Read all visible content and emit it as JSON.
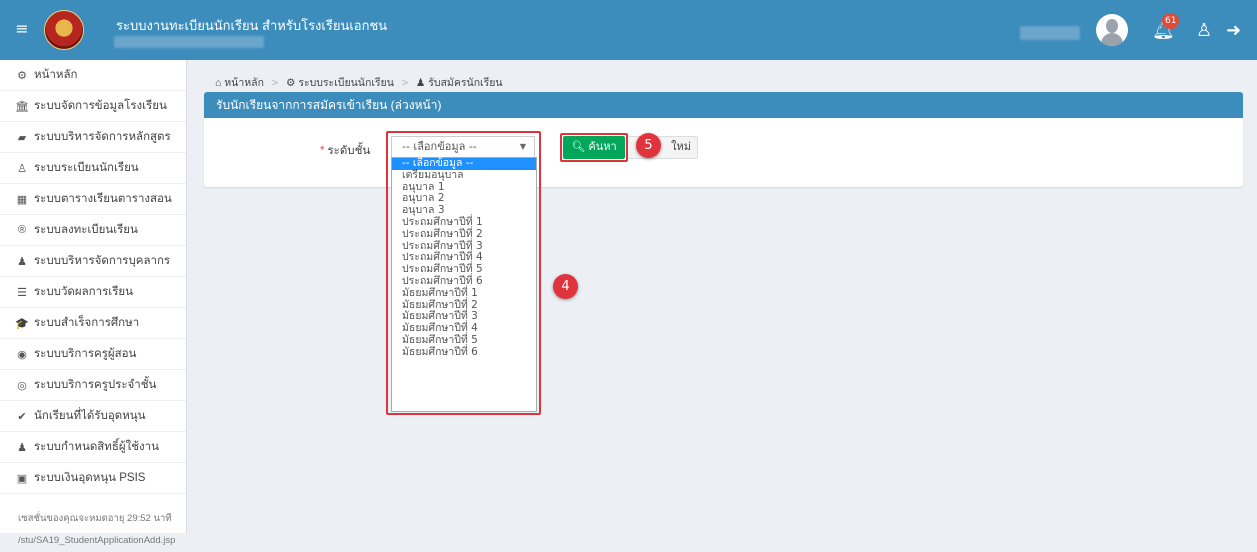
{
  "header": {
    "menu_icon": "hamburger-icon",
    "app_title": "ระบบงานทะเบียนนักเรียน สำหรับโรงเรียนเอกชน",
    "notifications_count": "61",
    "icons": [
      "bell-icon",
      "user-icon",
      "sign-out-icon"
    ],
    "brand_color": "#3c8dbc"
  },
  "sidebar": {
    "items": [
      {
        "icon": "⚙",
        "label": "หน้าหลัก"
      },
      {
        "icon": "🏛",
        "label": "ระบบจัดการข้อมูลโรงเรียน"
      },
      {
        "icon": "▰",
        "label": "ระบบบริหารจัดการหลักสูตร"
      },
      {
        "icon": "♙",
        "label": "ระบบระเบียนนักเรียน"
      },
      {
        "icon": "▦",
        "label": "ระบบตารางเรียนตารางสอน"
      },
      {
        "icon": "®",
        "label": "ระบบลงทะเบียนเรียน"
      },
      {
        "icon": "♟",
        "label": "ระบบบริหารจัดการบุคลากร"
      },
      {
        "icon": "☰",
        "label": "ระบบวัดผลการเรียน"
      },
      {
        "icon": "🎓",
        "label": "ระบบสำเร็จการศึกษา"
      },
      {
        "icon": "◉",
        "label": "ระบบบริการครูผู้สอน"
      },
      {
        "icon": "◎",
        "label": "ระบบบริการครูประจำชั้น"
      },
      {
        "icon": "✔",
        "label": "นักเรียนที่ได้รับอุดหนุน"
      },
      {
        "icon": "♟",
        "label": "ระบบกำหนดสิทธิ์ผู้ใช้งาน"
      },
      {
        "icon": "▣",
        "label": "ระบบเงินอุดหนุน PSIS"
      }
    ],
    "session_note": "เซสชั่นของคุณจะหมดอายุ 29:52 นาที",
    "page_path": "/stu/SA19_StudentApplicationAdd.jsp"
  },
  "breadcrumb": {
    "home": "หน้าหลัก",
    "section": "ระบบระเบียนนักเรียน",
    "current": "รับสมัครนักเรียน"
  },
  "panel": {
    "title": "รับนักเรียนจากการสมัครเข้าเรียน (ล่วงหน้า)"
  },
  "form": {
    "level_label": "ระดับชั้น",
    "required_mark": "*",
    "select_value": "-- เลือกข้อมูล --",
    "options": [
      "-- เลือกข้อมูล --",
      "เตรียมอนุบาล",
      "อนุบาล 1",
      "อนุบาล 2",
      "อนุบาล 3",
      "ประถมศึกษาปีที่ 1",
      "ประถมศึกษาปีที่ 2",
      "ประถมศึกษาปีที่ 3",
      "ประถมศึกษาปีที่ 4",
      "ประถมศึกษาปีที่ 5",
      "ประถมศึกษาปีที่ 6",
      "มัธยมศึกษาปีที่ 1",
      "มัธยมศึกษาปีที่ 2",
      "มัธยมศึกษาปีที่ 3",
      "มัธยมศึกษาปีที่ 4",
      "มัธยมศึกษาปีที่ 5",
      "มัธยมศึกษาปีที่ 6"
    ],
    "search_label": "ค้นหา",
    "reset_label": "ใหม่"
  },
  "callouts": {
    "dropdown_step": "4",
    "search_step": "5",
    "color": "#e0343d"
  }
}
